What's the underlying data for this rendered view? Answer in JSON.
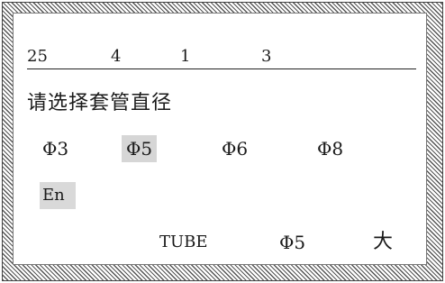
{
  "status": {
    "values": [
      "25",
      "4",
      "1",
      "3"
    ]
  },
  "prompt": "请选择套管直径",
  "options": [
    {
      "label": "Φ3",
      "selected": false
    },
    {
      "label": "Φ5",
      "selected": true
    },
    {
      "label": "Φ6",
      "selected": false
    },
    {
      "label": "Φ8",
      "selected": false
    }
  ],
  "lang_button": "En",
  "footer": {
    "type_label": "TUBE",
    "diameter": "Φ5",
    "size": "大"
  },
  "colors": {
    "selected_bg": "#d6d6d6",
    "frame_hatch": "#555555"
  }
}
